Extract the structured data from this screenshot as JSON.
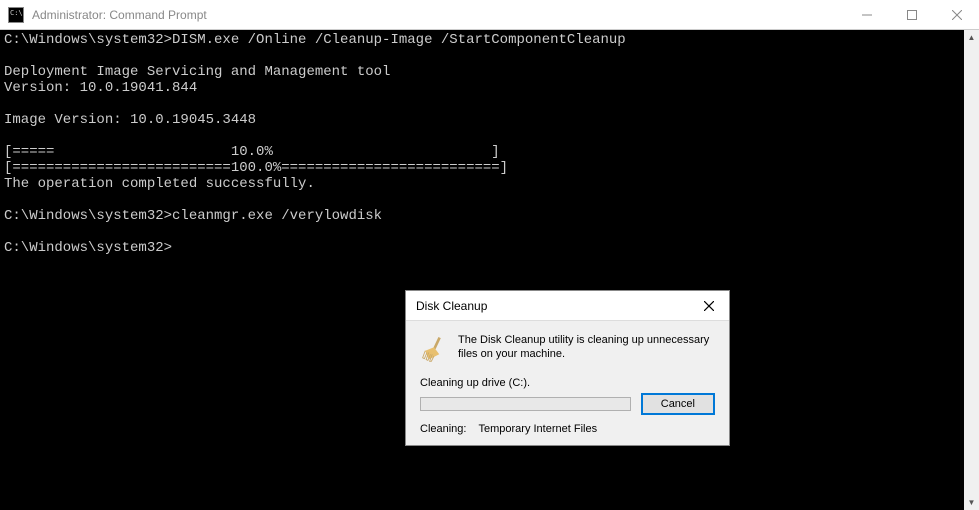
{
  "window": {
    "title": "Administrator: Command Prompt"
  },
  "terminal": {
    "line1": "C:\\Windows\\system32>DISM.exe /Online /Cleanup-Image /StartComponentCleanup",
    "line2": "",
    "line3": "Deployment Image Servicing and Management tool",
    "line4": "Version: 10.0.19041.844",
    "line5": "",
    "line6": "Image Version: 10.0.19045.3448",
    "line7": "",
    "line8": "[=====                     10.0%                          ]",
    "line9": "[==========================100.0%==========================]",
    "line10": "The operation completed successfully.",
    "line11": "",
    "line12": "C:\\Windows\\system32>cleanmgr.exe /verylowdisk",
    "line13": "",
    "line14": "C:\\Windows\\system32>"
  },
  "dialog": {
    "title": "Disk Cleanup",
    "message": "The Disk Cleanup utility is cleaning up unnecessary files on your machine.",
    "status": "Cleaning up drive  (C:).",
    "cancel": "Cancel",
    "cleaning_label": "Cleaning:",
    "cleaning_value": "Temporary Internet Files"
  }
}
